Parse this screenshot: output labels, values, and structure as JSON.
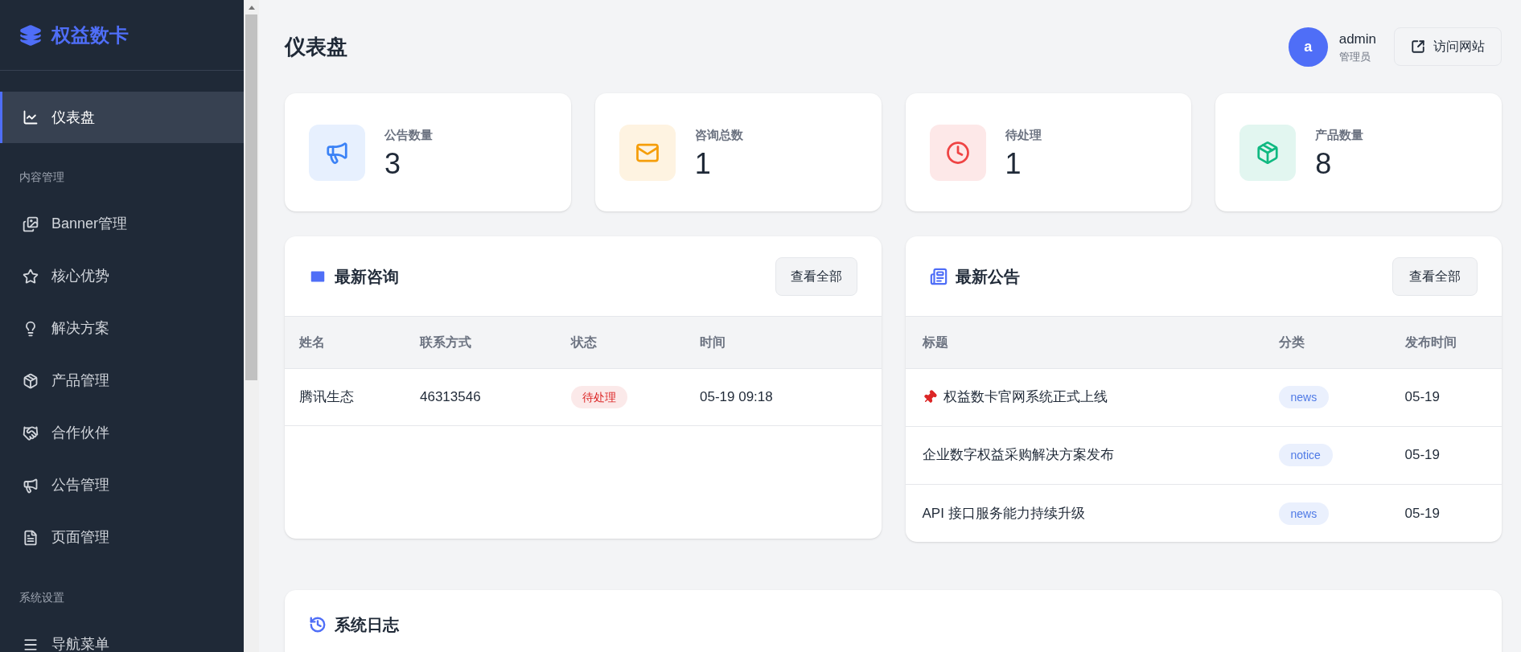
{
  "sidebar": {
    "logo": "权益数卡",
    "items": [
      {
        "kind": "chart",
        "label": "仪表盘",
        "selected": true
      }
    ],
    "sections": [
      {
        "label": "内容管理",
        "items": [
          {
            "kind": "images",
            "label": "Banner管理",
            "selected": false
          },
          {
            "kind": "star",
            "label": "核心优势",
            "selected": false
          },
          {
            "kind": "bulb",
            "label": "解决方案",
            "selected": false
          },
          {
            "kind": "box",
            "label": "产品管理",
            "selected": false
          },
          {
            "kind": "handshake",
            "label": "合作伙伴",
            "selected": false
          },
          {
            "kind": "megaphone",
            "label": "公告管理",
            "selected": false
          },
          {
            "kind": "file",
            "label": "页面管理",
            "selected": false
          }
        ]
      },
      {
        "label": "系统设置",
        "items": [
          {
            "kind": "menu",
            "label": "导航菜单",
            "selected": false
          }
        ]
      }
    ]
  },
  "header": {
    "title": "仪表盘",
    "user": {
      "initial": "a",
      "name": "admin",
      "role": "管理员"
    },
    "visit_button": "访问网站"
  },
  "stats": [
    {
      "kind": "megaphone",
      "label": "公告数量",
      "value": "3",
      "color": "#3b82f6"
    },
    {
      "kind": "mail",
      "label": "咨询总数",
      "value": "1",
      "color": "#f59e0b"
    },
    {
      "kind": "clock",
      "label": "待处理",
      "value": "1",
      "color": "#ef4444"
    },
    {
      "kind": "box",
      "label": "产品数量",
      "value": "8",
      "color": "#10b981"
    }
  ],
  "inquiries": {
    "title": "最新咨询",
    "view_all": "查看全部",
    "columns": [
      "姓名",
      "联系方式",
      "状态",
      "时间"
    ],
    "rows": [
      {
        "name": "腾讯生态",
        "contact": "46313546",
        "status": "待处理",
        "color": "#dc2626",
        "time": "05-19 09:18"
      }
    ]
  },
  "announcements": {
    "title": "最新公告",
    "view_all": "查看全部",
    "columns": [
      "标题",
      "分类",
      "发布时间"
    ],
    "rows": [
      {
        "pinned": true,
        "title": "权益数卡官网系统正式上线",
        "category": "news",
        "date": "05-19"
      },
      {
        "pinned": false,
        "title": "企业数字权益采购解决方案发布",
        "category": "notice",
        "date": "05-19"
      },
      {
        "pinned": false,
        "title": "API 接口服务能力持续升级",
        "category": "news",
        "date": "05-19"
      }
    ]
  },
  "system_log": {
    "title": "系统日志"
  }
}
